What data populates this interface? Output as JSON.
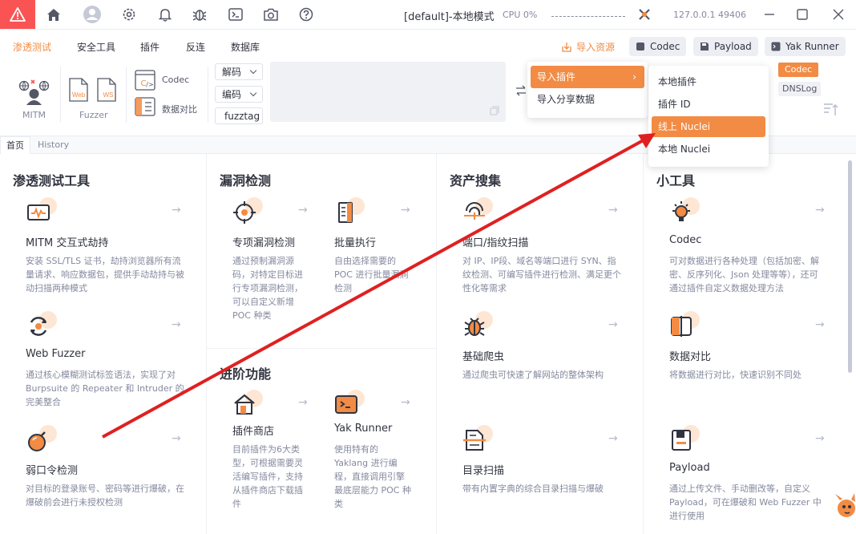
{
  "titlebar": {
    "title": "[default]-本地模式",
    "cpu": "CPU 0%",
    "address": "127.0.0.1 49406"
  },
  "menu": {
    "items": [
      "渗透测试",
      "安全工具",
      "插件",
      "反连",
      "数据库"
    ],
    "import_resources": "导入资源",
    "codec": "Codec",
    "payload": "Payload",
    "yak_runner": "Yak Runner"
  },
  "toolbar": {
    "mitm": "MITM",
    "fuzzer": "Fuzzer",
    "web": "Web",
    "ws": "WS",
    "codec": "Codec",
    "compare": "数据对比",
    "decode": "解码",
    "encode": "编码",
    "fuzztag": "fuzztag",
    "codec_badge": "Codec",
    "dnslog": "DNSLog"
  },
  "tabs": [
    "首页",
    "History"
  ],
  "import_menu": {
    "items": [
      "导入插件",
      "导入分享数据"
    ],
    "submenu": [
      "本地插件",
      "插件 ID",
      "线上 Nuclei",
      "本地 Nuclei"
    ]
  },
  "sections": {
    "pentest": {
      "title": "渗透测试工具",
      "cards": [
        {
          "title": "MITM 交互式劫持",
          "desc": "安装 SSL/TLS 证书，劫持浏览器所有流量请求、响应数据包，提供手动劫持与被动扫描两种模式"
        },
        {
          "title": "Web Fuzzer",
          "desc": "通过核心模糊测试标签语法，实现了对 Burpsuite 的 Repeater 和 Intruder 的完美整合"
        },
        {
          "title": "弱口令检测",
          "desc": "对目标的登录账号、密码等进行爆破，在爆破前会进行未授权检测"
        }
      ]
    },
    "vuln": {
      "title": "漏洞检测",
      "cards": [
        {
          "title": "专项漏洞检测",
          "desc": "通过预制漏洞源码，对特定目标进行专项漏洞检测，可以自定义新增 POC 种类"
        },
        {
          "title": "批量执行",
          "desc": "自由选择需要的 POC 进行批量漏洞检测"
        }
      ]
    },
    "advanced": {
      "title": "进阶功能",
      "cards": [
        {
          "title": "插件商店",
          "desc": "目前插件为6大类型，可根据需要灵活编写插件，支持从插件商店下载插件"
        },
        {
          "title": "Yak Runner",
          "desc": "使用特有的 Yaklang 进行编程，直接调用引擎最底层能力 POC 种类"
        }
      ]
    },
    "asset": {
      "title": "资产搜集",
      "cards": [
        {
          "title": "端口/指纹扫描",
          "desc": "对 IP、IP段、域名等端口进行 SYN、指纹检测、可编写插件进行检测、满足更个性化等需求"
        },
        {
          "title": "基础爬虫",
          "desc": "通过爬虫可快速了解网站的整体架构"
        },
        {
          "title": "目录扫描",
          "desc": "带有内置字典的综合目录扫描与爆破"
        }
      ]
    },
    "tools": {
      "title": "小工具",
      "cards": [
        {
          "title": "Codec",
          "desc": "可对数据进行各种处理（包括加密、解密、反序列化、Json 处理等等），还可通过插件自定义数据处理方法"
        },
        {
          "title": "数据对比",
          "desc": "将数据进行对比，快速识别不同处"
        },
        {
          "title": "Payload",
          "desc": "通过上传文件、手动删改等，自定义 Payload，可在爆破和 Web Fuzzer 中进行使用"
        }
      ]
    }
  },
  "colors": {
    "accent": "#f28b44",
    "annotation_arrow": "#e02020",
    "warning": "#f95353"
  }
}
